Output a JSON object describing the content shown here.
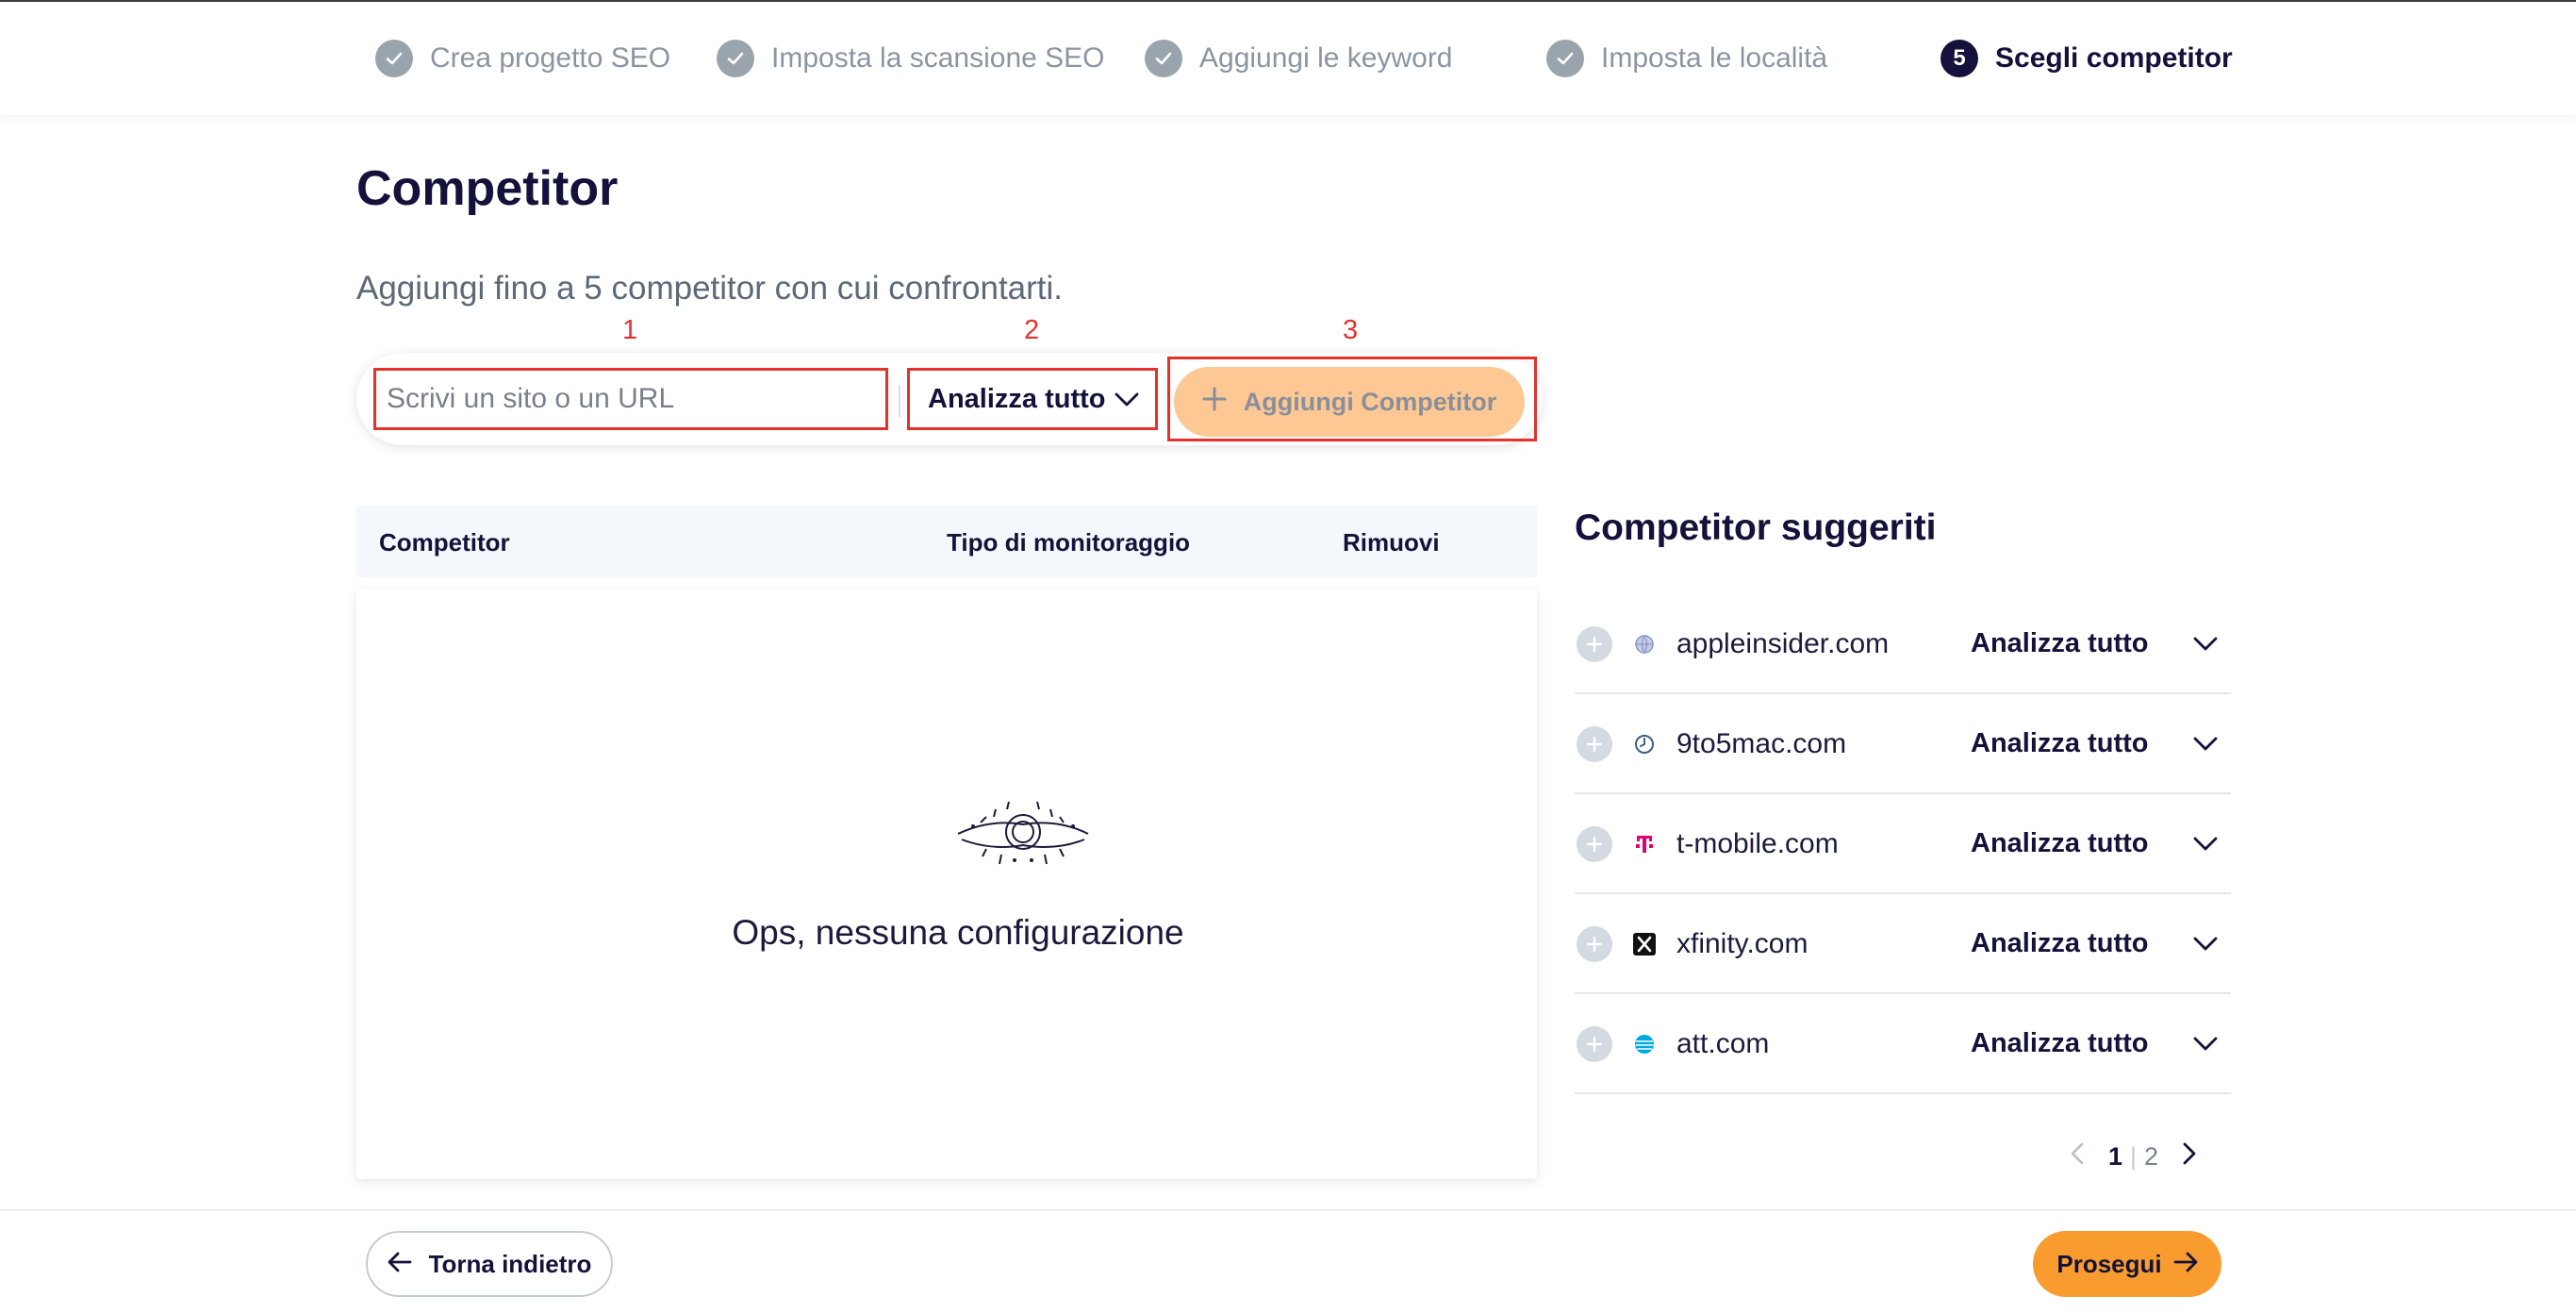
{
  "stepper": {
    "steps": [
      {
        "label": "Crea progetto SEO",
        "state": "done"
      },
      {
        "label": "Imposta la scansione SEO",
        "state": "done"
      },
      {
        "label": "Aggiungi le keyword",
        "state": "done"
      },
      {
        "label": "Imposta le località",
        "state": "done"
      },
      {
        "label": "Scegli competitor",
        "state": "active",
        "number": "5"
      }
    ]
  },
  "page": {
    "title": "Competitor",
    "subtitle": "Aggiungi fino a 5 competitor con cui confrontarti."
  },
  "annotations": [
    "1",
    "2",
    "3"
  ],
  "form": {
    "url_placeholder": "Scrivi un sito o un URL",
    "url_value": "",
    "select_value": "Analizza tutto",
    "add_label": "Aggiungi Competitor"
  },
  "table": {
    "columns": [
      "Competitor",
      "Tipo di monitoraggio",
      "Rimuovi"
    ],
    "empty_text": "Ops, nessuna configurazione"
  },
  "suggested": {
    "title": "Competitor suggeriti",
    "items": [
      {
        "domain": "appleinsider.com",
        "mode": "Analizza tutto",
        "icon": "globe-icon"
      },
      {
        "domain": "9to5mac.com",
        "mode": "Analizza tutto",
        "icon": "clock-icon"
      },
      {
        "domain": "t-mobile.com",
        "mode": "Analizza tutto",
        "icon": "t-mobile-logo-icon"
      },
      {
        "domain": "xfinity.com",
        "mode": "Analizza tutto",
        "icon": "x-logo-icon"
      },
      {
        "domain": "att.com",
        "mode": "Analizza tutto",
        "icon": "att-globe-icon"
      }
    ],
    "pagination": {
      "current": "1",
      "separator": "|",
      "other": "2"
    }
  },
  "footer": {
    "back_label": "Torna indietro",
    "next_label": "Prosegui"
  },
  "colors": {
    "primary_dark": "#14123a",
    "accent_orange": "#f99c2f",
    "accent_orange_light": "#fdc894",
    "done_grey": "#9aa4ad",
    "annotation_red": "#e4322b"
  }
}
